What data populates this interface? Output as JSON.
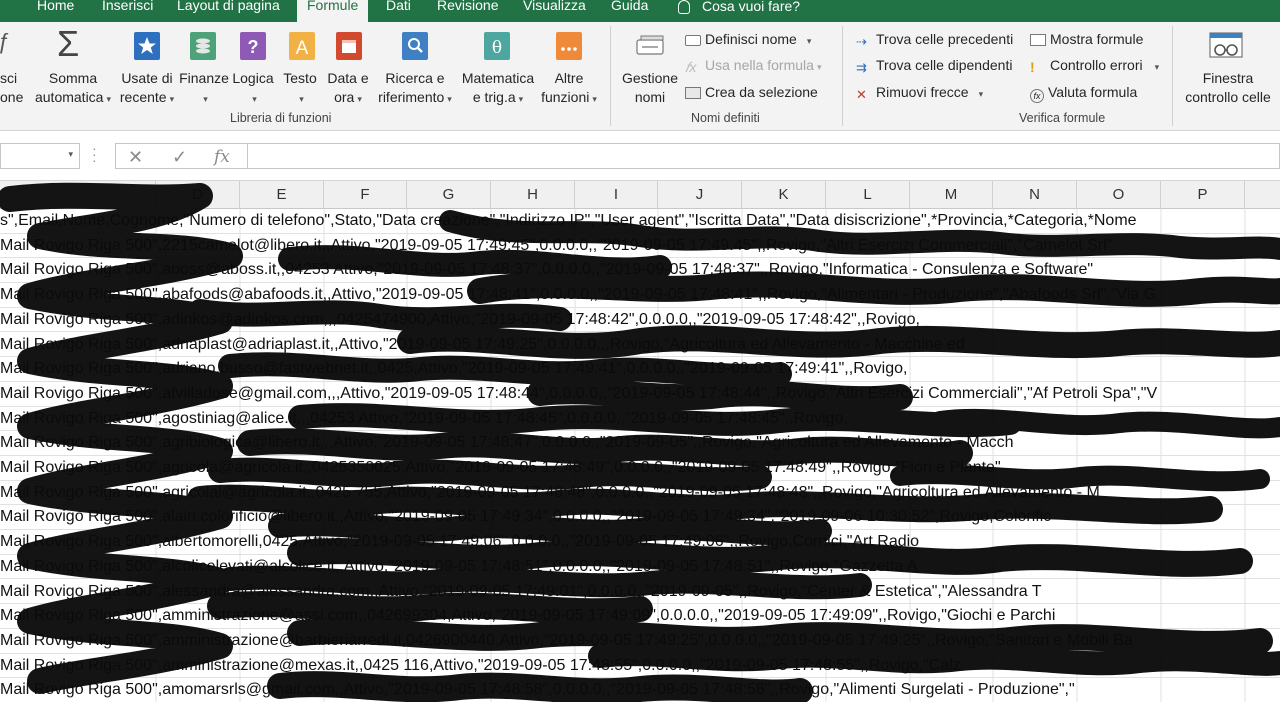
{
  "tabs": [
    {
      "label": "Home",
      "active": false
    },
    {
      "label": "Inserisci",
      "active": false
    },
    {
      "label": "Layout di pagina",
      "active": false
    },
    {
      "label": "Formule",
      "active": true
    },
    {
      "label": "Dati",
      "active": false
    },
    {
      "label": "Revisione",
      "active": false
    },
    {
      "label": "Visualizza",
      "active": false
    },
    {
      "label": "Guida",
      "active": false
    }
  ],
  "tell_me": "Cosa vuoi fare?",
  "ribbon": {
    "insert_fn": {
      "line1": "sci",
      "line2": "one"
    },
    "library": {
      "label": "Libreria di funzioni",
      "autosum": {
        "line1": "Somma",
        "line2": "automatica"
      },
      "recent": {
        "line1": "Usate di",
        "line2": "recente"
      },
      "finance": "Finanze",
      "logic": "Logica",
      "text": "Testo",
      "datetime": {
        "line1": "Data e",
        "line2": "ora"
      },
      "lookup": {
        "line1": "Ricerca e",
        "line2": "riferimento"
      },
      "math": {
        "line1": "Matematica",
        "line2": "e trig.a"
      },
      "other": {
        "line1": "Altre",
        "line2": "funzioni"
      }
    },
    "names": {
      "label": "Nomi definiti",
      "manager": {
        "line1": "Gestione",
        "line2": "nomi"
      },
      "define": "Definisci nome",
      "use_in_formula": "Usa nella formula",
      "create_from_sel": "Crea da selezione"
    },
    "audit": {
      "label": "Verifica formule",
      "trace_precedents": "Trova celle precedenti",
      "trace_dependents": "Trova celle dipendenti",
      "remove_arrows": "Rimuovi frecce",
      "show_formulas": "Mostra formule",
      "error_check": "Controllo errori",
      "evaluate": "Valuta formula"
    },
    "watch": {
      "line1": "Finestra",
      "line2": "controllo celle"
    }
  },
  "formula_bar": {
    "fx": "fx",
    "cancel": "✕",
    "enter": "✓",
    "value": ""
  },
  "columns": [
    "D",
    "E",
    "F",
    "G",
    "H",
    "I",
    "J",
    "K",
    "L",
    "M",
    "N",
    "O",
    "P"
  ],
  "rows": [
    "s\",Email,Nome,Cognome,\"Numero di telefono\",Stato,\"Data creazione\",\"Indirizzo IP\",\"User agent\",\"Iscritta Data\",\"Data disiscrizione\",*Provincia,*Categoria,*Nome",
    "Mail Rovigo Riga 500\",2215camelot@libero.it,,Attivo,\"2019-09-05 17:49:45\",0.0.0.0,,\"2019-09-05 17:49:45\",,Rovigo,\"Altri Esercizi Commerciali\",\"Camelot Srl\"",
    "Mail Rovigo Riga 500\",aboss@aboss.it,,04253 Attivo,\"2019-09-05 17:48:37\",0.0.0.0,,\"2019-09-05 17:48:37\",,Rovigo,\"Informatica - Consulenza e Software\"",
    "Mail Rovigo Riga 500\",abafoods@abafoods.it,,Attivo,\"2019-09-05 17:48:41\",0.0.0.0,,\"2019-09-05 17:48:41\",,Rovigo,\"Alimentari - Produzione\",\"Abafoods Srl\",\"Via G",
    "Mail Rovigo Riga 500\",adinkos@adinkos.com,,,0425474900,Attivo,\"2019-09-05 17:48:42\",0.0.0.0,,\"2019-09-05 17:48:42\",,Rovigo,",
    "Mail Rovigo Riga 500\",adriaplast@adriaplast.it,,Attivo,\"2019-09-05 17:49:25\",0.0.0.0,,,Rovigo,\"Agricoltura ed Allevamento - Macchine ed",
    "Mail Rovigo Riga 500\",adriano.busso@fastwebnet.it,,0425,Attivo,\"2019-09-05 17:49:41\",0.0.0.0,,\"2019-09-05 17:49:41\",,Rovigo,",
    "Mail Rovigo Riga 500\",afvilladose@gmail.com,,,Attivo,\"2019-09-05 17:48:44\",0.0.0.0,,\"2019-09-05 17:48:44\",,Rovigo,\"Altri Esercizi Commerciali\",\"Af Petroli Spa\",\"V",
    "Mail Rovigo Riga 500\",agostiniag@alice.it,,,04253 Attivo,\"2019-09-05 17:48:45\",0.0.0.0,,\"2019-09-05 17:48:45\",,Rovigo,",
    "Mail Rovigo Riga 500\",agribiologica@libero.it,,,Attivo,\"2019-09-05 17:48:47\",0.0.0.0,,\"2019-09-05\",,Rovigo,\"Agricoltura ed Allevamento - Macch",
    "Mail Rovigo Riga 500\",agricola@agricola.it,,0425350025,Attivo,\"2019-09-05 17:48:49\",0.0.0.0,,\"2019-09-05 17:48:49\",,Rovigo,\"Fiori e Piante\"",
    "Mail Rovigo Riga 500\",agricolal@agricola.it,,0425 755,Attivo,\"2019-09-05 17:48:48\",0.0.0.0,,\"2019-09-05 17:48:48\",,Rovigo,\"Agricoltura ed Allevamento - M",
    "Mail Rovigo Riga 500\",alain.colorificio@libero.it,,Attivo,\"2019-09-05 17:49:34\",0.0.0.0,,\"2019-09-05 17:49:34\",\"2019-09-06 10:30:52\",Rovigo,Colorific",
    "Mail Rovigo Riga 500\",albertomorelli,0425,Attivo,\"2019-09-05 17:49:06\",0.0.0.0,,\"2019-09-05 17:49:06\",,Rovigo,Cornici,\"Art Radio",
    "Mail Rovigo Riga 500\",alcolicelevati@alcolice.it,,Attivo,\"2019-09-05 17:48:51\",0.0.0.0,,\"2019-09-05 17:48:51\",,Rovigo,\"Gazzetta A",
    "Mail Rovigo Riga 500\",alessandra@alessandra.com,,Attivo,\"2019-09-05 17:49:01\",0.0.0.0,,\"2019-09-05\",,Rovigo,\"Center & Estetica\",\"Alessandra T",
    "Mail Rovigo Riga 500\",amministrazione@assi.com,,042699304,Attivo,\"2019-09-05 17:49:09\",0.0.0.0,,\"2019-09-05 17:49:09\",,Rovigo,\"Giochi e Parchi",
    "Mail Rovigo Riga 500\",amministrazione@barbieriarredi.it,0426900440,Attivo,\"2019-09-05 17:49:25\",0.0.0.0,,\"2019-09-05 17:49:25\",,Rovigo,\"Sanitari e Mobili Ba",
    "Mail Rovigo Riga 500\",amministrazione@mexas.it,,0425 116,Attivo,\"2019-09-05 17:48:55\",0.0.0.0,,\"2019-09-05 17:48:55\",,Rovigo,\"Calz",
    "Mail Rovigo Riga 500\",amomarsrls@gmail.com,,Attivo,\"2019-09-05 17:48:58\",0.0.0.0,,\"2019-09-05 17:48:58\",,Rovigo,\"Alimenti Surgelati - Produzione\",\""
  ]
}
